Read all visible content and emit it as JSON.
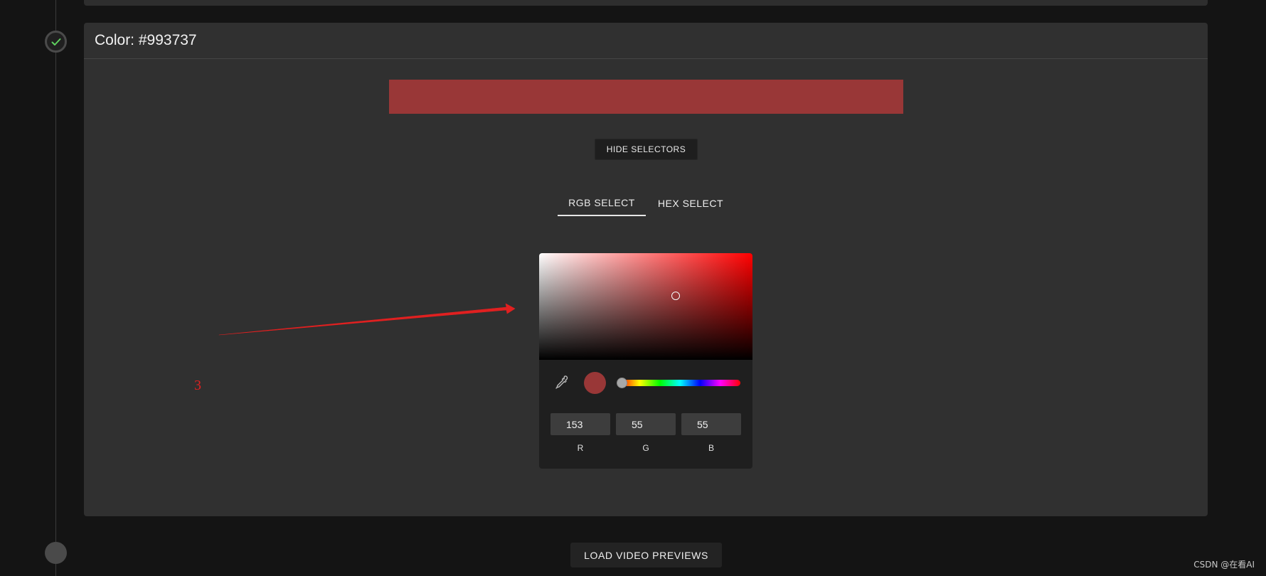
{
  "card": {
    "title": "Color: #993737",
    "selected_color": "#993737"
  },
  "buttons": {
    "hide_selectors": "HIDE SELECTORS",
    "load_video_previews": "LOAD VIDEO PREVIEWS"
  },
  "tabs": [
    {
      "label": "RGB SELECT",
      "active": true
    },
    {
      "label": "HEX SELECT",
      "active": false
    }
  ],
  "picker": {
    "hue_color": "#ff0000",
    "hue_value": 0,
    "r": "153",
    "g": "55",
    "b": "55",
    "r_label": "R",
    "g_label": "G",
    "b_label": "B"
  },
  "annotation": {
    "number": "3",
    "color": "#e02020"
  },
  "watermark": "CSDN @在看AI",
  "icons": {
    "step_done": "check-icon",
    "eyedropper": "eyedropper-icon"
  }
}
